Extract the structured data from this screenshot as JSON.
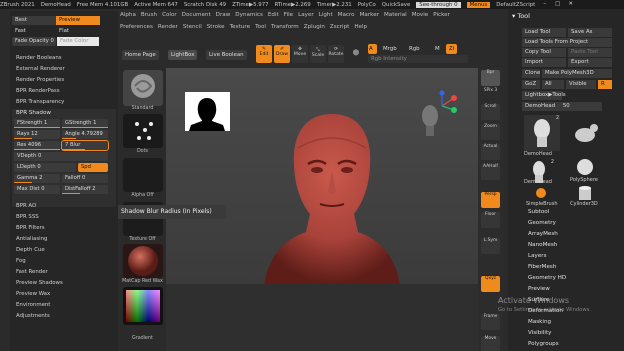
{
  "titlebar": {
    "app": "ZBrush 2021",
    "doc": "DemoHead",
    "free_mem": "Free Mem 4.101GB",
    "active_mem": "Active Mem 647",
    "scratch": "Scratch Disk 49",
    "ztime": "ZTime▶5.977",
    "rtime": "RTime▶2.269",
    "timer": "Timer▶2.231",
    "polycount": "PolyCo",
    "quicksave": "QuickSave",
    "see_through": "See-through 0",
    "menus": "Menus",
    "script": "DefaultZScript"
  },
  "menu_row1": [
    "Alpha",
    "Brush",
    "Color",
    "Document",
    "Draw",
    "Dynamics",
    "Edit",
    "File",
    "Layer",
    "Light",
    "Macro",
    "Marker",
    "Material",
    "Movie",
    "Picker"
  ],
  "menu_row2": [
    "Preferences",
    "Render",
    "Stencil",
    "Stroke",
    "Texture",
    "Tool",
    "Transform",
    "Zplugin",
    "Zscript",
    "Help"
  ],
  "left": {
    "best": "Best",
    "preview": "Preview",
    "fast": "Fast",
    "flat": "Flat",
    "fade_opacity": "Fade Opacity",
    "fade_opacity_value": "0",
    "fade_color": "Fade Color",
    "items_top": [
      "Render Booleans",
      "External Renderer",
      "Render Properties",
      "BPR RenderPass",
      "BPR Transparency"
    ],
    "bpr_shadow": "BPR Shadow",
    "fstrength": "FStrength 1",
    "gstrength": "GStrength 1",
    "rays": "Rays 12",
    "angle": "Angle 4.79289",
    "res": "Res 4096",
    "blur": "Blur",
    "vdepth": "VDepth 0",
    "ldepth": "LDepth 0",
    "spd": "Spd",
    "gamma": "Gamma 2",
    "falloff": "Falloff 0",
    "max_dist": "Max Dist 0",
    "dist_falloff": "DistFalloff 2",
    "items_bottom": [
      "BPR AO",
      "BPR SSS",
      "BPR Filters",
      "Antialiasing",
      "Depth Cue",
      "Fog",
      "Fast Render",
      "Preview Shadows",
      "Preview Wax",
      "Environment",
      "Adjustments"
    ]
  },
  "toolbar": {
    "home": "Home Page",
    "lightbox": "LightBox",
    "live_boolean": "Live Boolean",
    "edit": "Edit",
    "draw": "Draw",
    "move": "Move",
    "scale": "Scale",
    "rotate": "Rotate",
    "a": "A",
    "mrgb": "Mrgb",
    "rgb": "Rgb",
    "m": "M",
    "z": "Zi",
    "rgb_intensity": "Rgb Intensity"
  },
  "thumbs": {
    "standard": "Standard",
    "dots": "Dots",
    "alpha_off": "Alpha Off",
    "texture_off": "Texture Off",
    "matcap": "MatCap Red Wax",
    "gradient": "Gradient"
  },
  "tooltip": "Shadow Blur Radius (In Pixels)",
  "rightstrip": [
    "Bpr",
    "SPix 3",
    "Scroll",
    "Zoom",
    "Actual",
    "AAHalf",
    "Persp",
    "Floor",
    "L.Sym",
    "Qxyz",
    "Frame",
    "Move"
  ],
  "tool": {
    "title": "Tool",
    "load_tool": "Load Tool",
    "save_as": "Save As",
    "load_from_project": "Load Tools From Project",
    "copy_tool": "Copy Tool",
    "paste_tool": "Paste Tool",
    "import": "Import",
    "export": "Export",
    "clone": "Clone",
    "make_polymesh": "Make PolyMesh3D",
    "goz": "GoZ",
    "all": "All",
    "visible": "Visible",
    "r": "R",
    "lightbox_tools": "Lightbox▶Tools",
    "current_tool": "DemoHead",
    "current_value": "50",
    "models": [
      "DemoHead",
      "Dog",
      "DemoHead",
      "PolySphere",
      "Cylinder3D",
      "SimpleBrush"
    ],
    "model_counts": [
      "2",
      "2"
    ],
    "menu_items": [
      "Subtool",
      "Geometry",
      "ArrayMesh",
      "NanoMesh",
      "Layers",
      "FiberMesh",
      "Geometry HD",
      "Preview",
      "Surface",
      "Deformation",
      "Masking",
      "Visibility",
      "Polygroups"
    ]
  },
  "watermark": {
    "line1": "Activate Windows",
    "line2": "Go to Settings to activate Windows."
  },
  "colors": {
    "accent": "#f08a1c",
    "panel": "#262626",
    "head": "#b5473c"
  }
}
